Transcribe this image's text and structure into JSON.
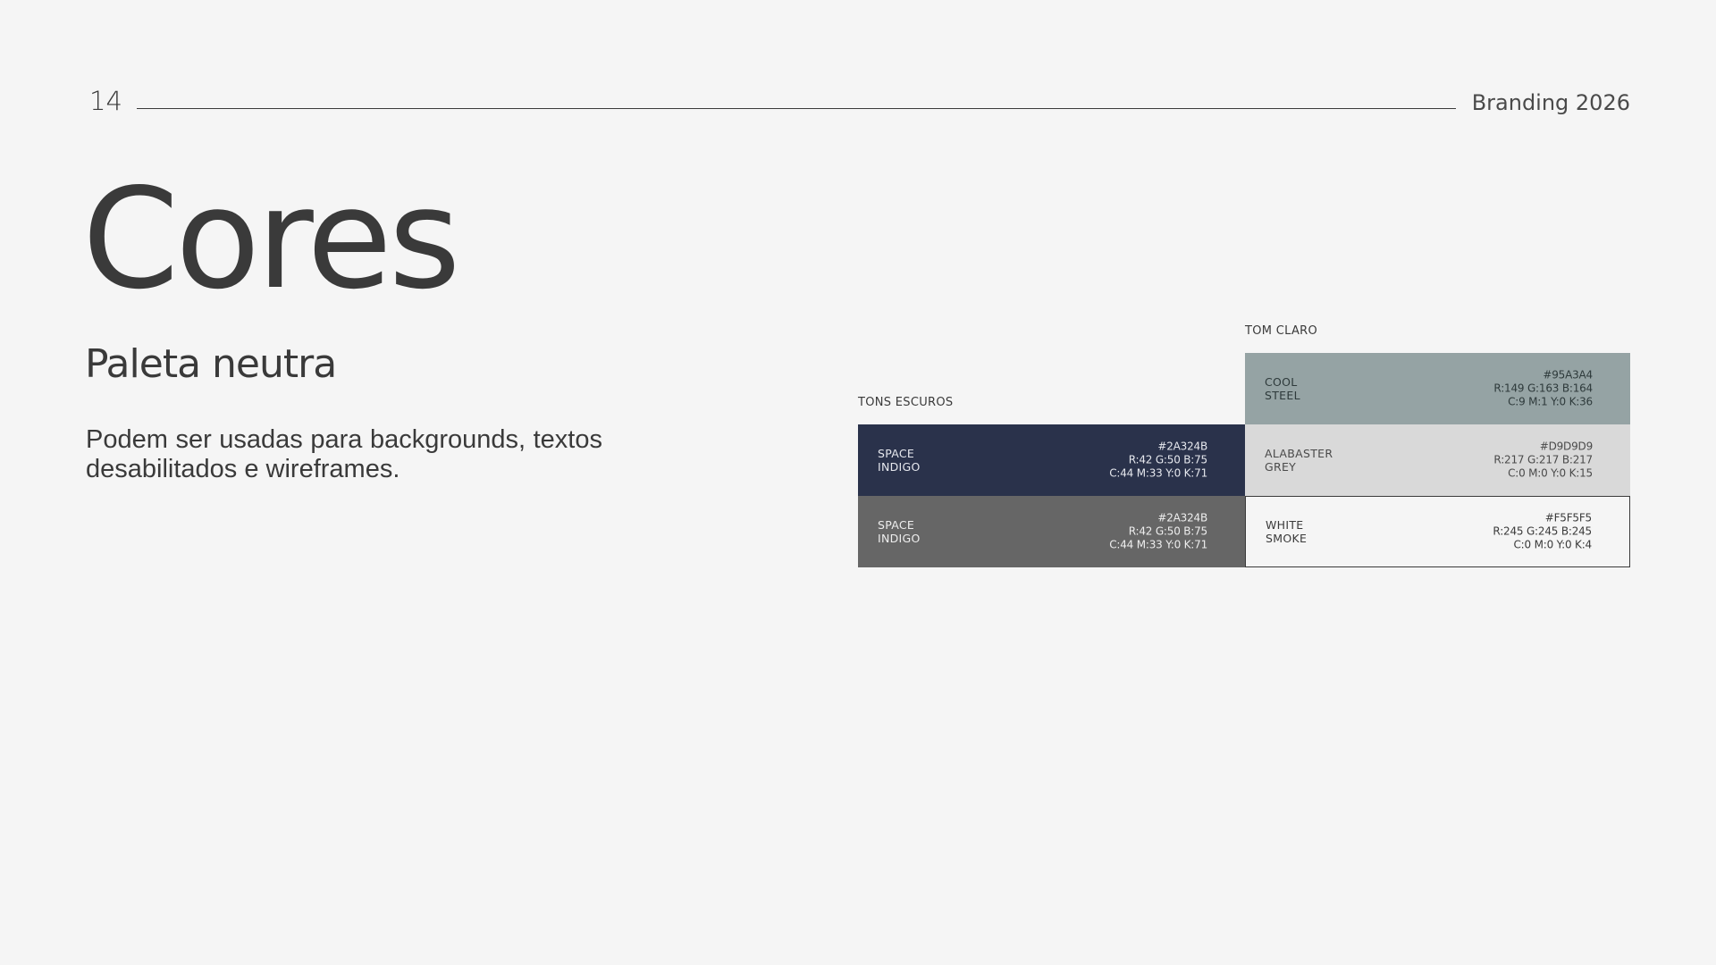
{
  "header": {
    "page_number": "14",
    "brand": "Branding 2026"
  },
  "title": "Cores",
  "subtitle": "Paleta neutra",
  "description": "Podem ser usadas para backgrounds, textos desabilitados e wireframes.",
  "groups": {
    "dark_label": "TONS ESCUROS",
    "light_label": "TOM CLARO"
  },
  "swatches": [
    {
      "name_line1": "SPACE",
      "name_line2": "INDIGO",
      "hex": "#2A324B",
      "rgb": "R:42 G:50 B:75",
      "cmyk": "C:44 M:33 Y:0 K:71",
      "fill": "#2A324B"
    },
    {
      "name_line1": "SPACE",
      "name_line2": "INDIGO",
      "hex": "#2A324B",
      "rgb": "R:42 G:50 B:75",
      "cmyk": "C:44 M:33 Y:0 K:71",
      "fill": "#666666"
    },
    {
      "name_line1": "COOL",
      "name_line2": "STEEL",
      "hex": "#95A3A4",
      "rgb": "R:149 G:163 B:164",
      "cmyk": "C:9 M:1 Y:0 K:36",
      "fill": "#95A3A4"
    },
    {
      "name_line1": "ALABASTER",
      "name_line2": "GREY",
      "hex": "#D9D9D9",
      "rgb": "R:217 G:217 B:217",
      "cmyk": "C:0 M:0 Y:0 K:15",
      "fill": "#D9D9D9"
    },
    {
      "name_line1": "WHITE",
      "name_line2": "SMOKE",
      "hex": "#F5F5F5",
      "rgb": "R:245 G:245 B:245",
      "cmyk": "C:0 M:0 Y:0 K:4",
      "fill": "#F5F5F5"
    }
  ]
}
